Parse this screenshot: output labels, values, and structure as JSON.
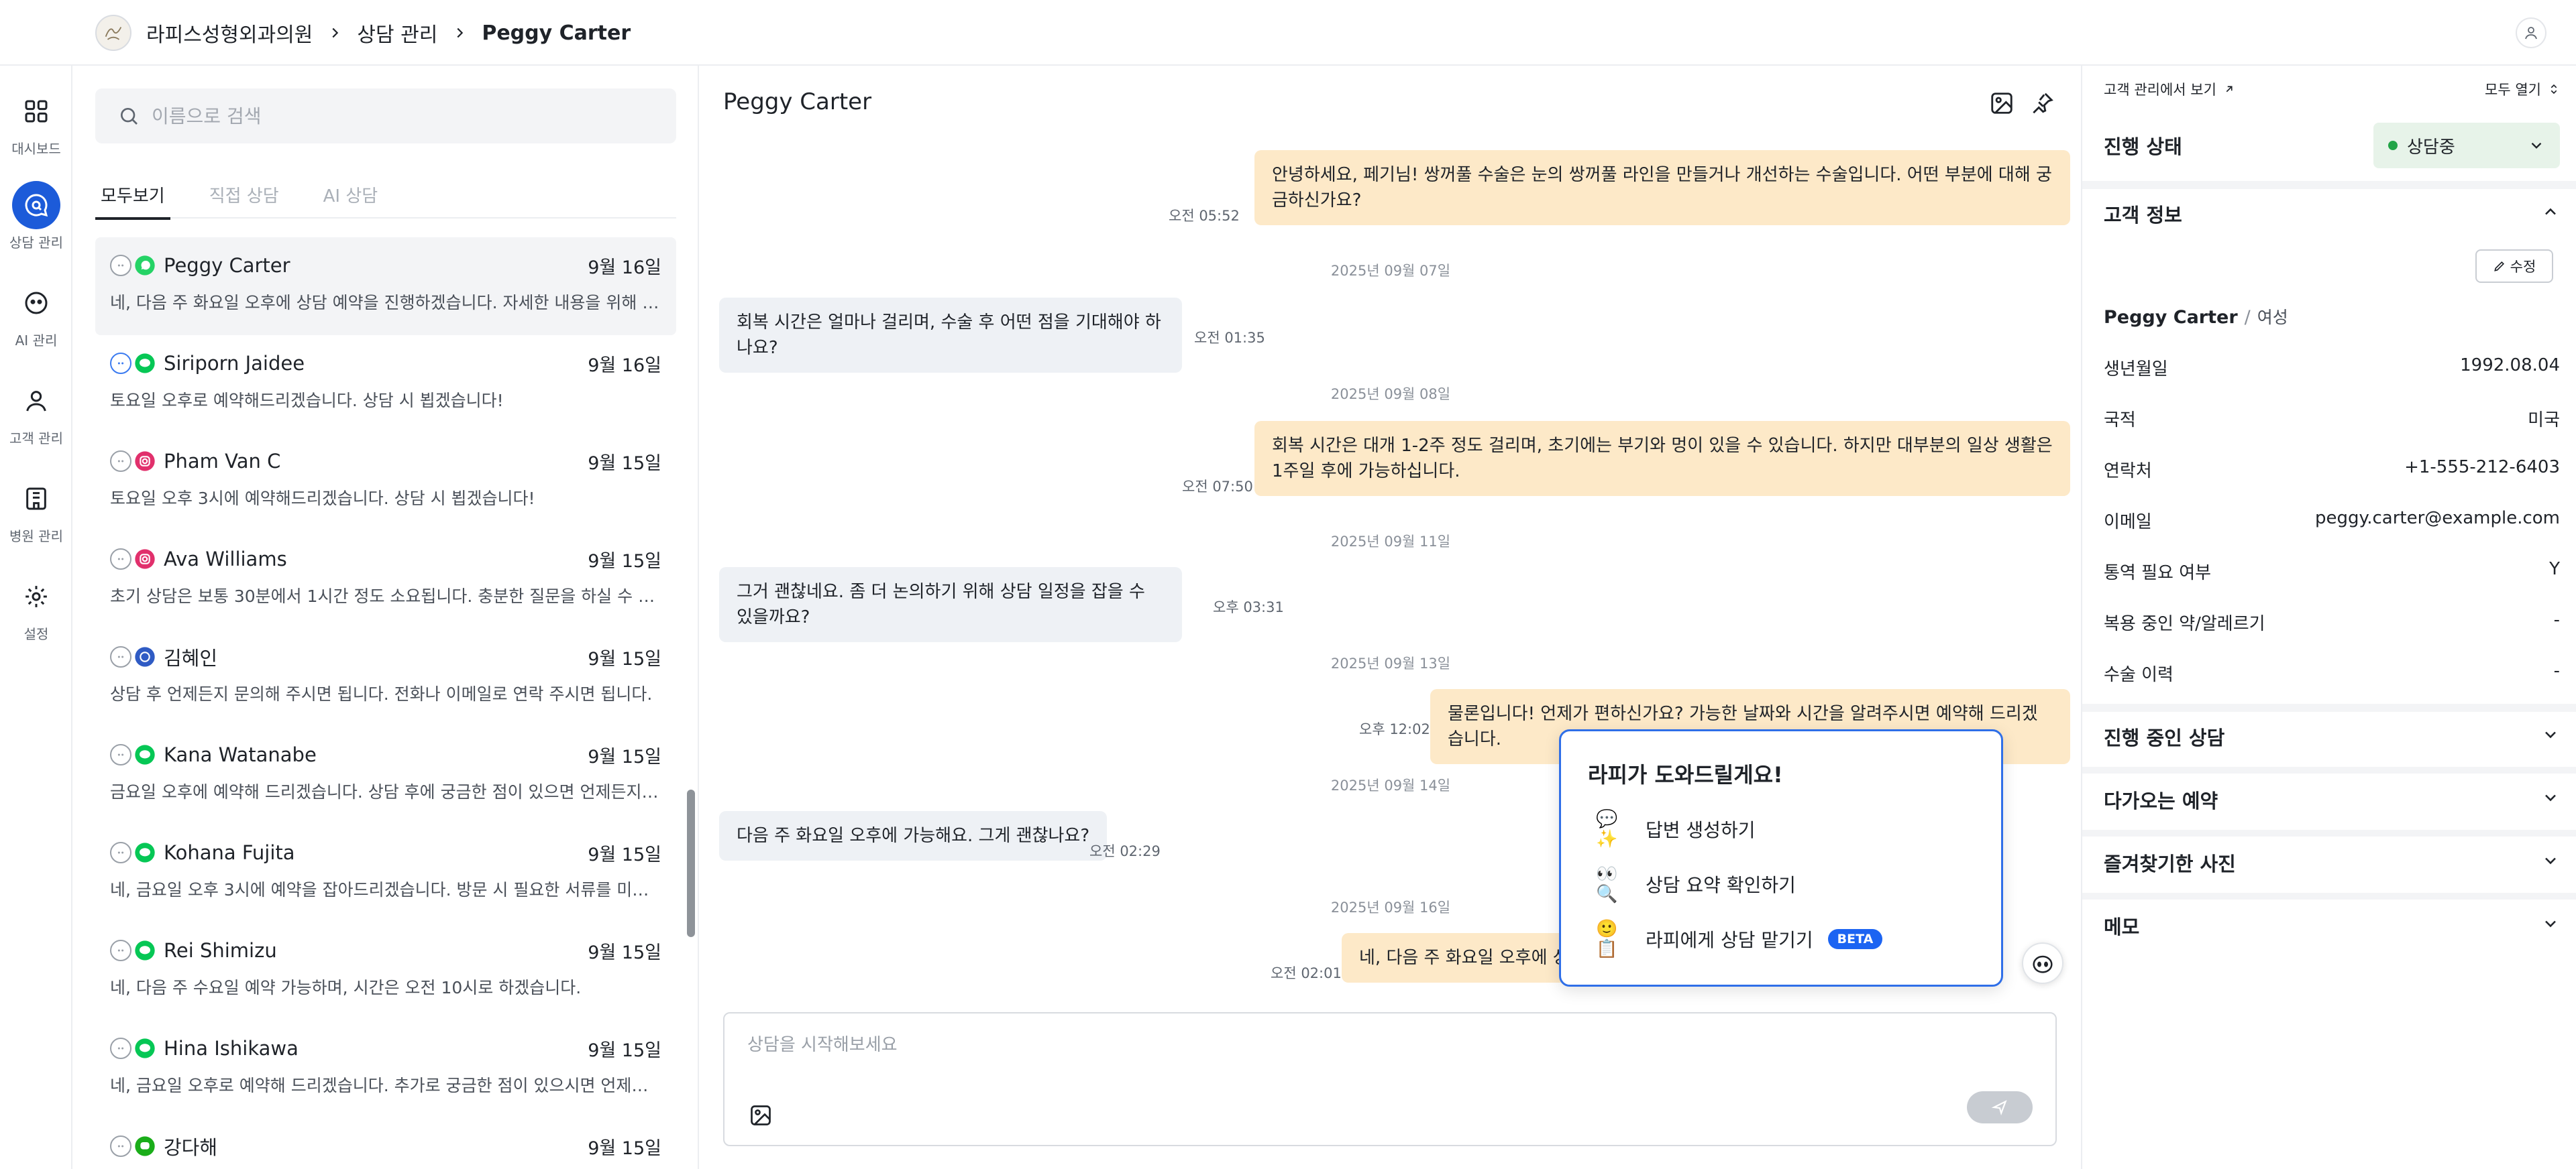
{
  "header": {
    "breadcrumb": [
      "라피스성형외과의원",
      "상담 관리",
      "Peggy Carter"
    ]
  },
  "nav": [
    {
      "label": "대시보드",
      "icon": "grid-icon"
    },
    {
      "label": "상담 관리",
      "icon": "chat-search-icon",
      "active": true
    },
    {
      "label": "AI 관리",
      "icon": "robot-icon"
    },
    {
      "label": "고객 관리",
      "icon": "user-icon"
    },
    {
      "label": "병원 관리",
      "icon": "building-icon"
    },
    {
      "label": "설정",
      "icon": "gear-icon"
    }
  ],
  "search": {
    "placeholder": "이름으로 검색"
  },
  "tabs": [
    "모두보기",
    "직접 상담",
    "AI 상담"
  ],
  "conversations": [
    {
      "name": "Peggy Carter",
      "date": "9월 16일",
      "channel": "whatsapp",
      "message": "네, 다음 주 화요일 오후에 상담 예약을 진행하겠습니다. 자세한 내용을 위해 문의해 주셔서 감사합니다."
    },
    {
      "name": "Siriporn Jaidee",
      "date": "9월 16일",
      "channel": "line",
      "message": "토요일 오후로 예약해드리겠습니다. 상담 시 뵙겠습니다!"
    },
    {
      "name": "Pham Van C",
      "date": "9월 15일",
      "channel": "instagram",
      "message": "토요일 오후 3시에 예약해드리겠습니다. 상담 시 뵙겠습니다!"
    },
    {
      "name": "Ava Williams",
      "date": "9월 15일",
      "channel": "instagram",
      "message": "초기 상담은 보통 30분에서 1시간 정도 소요됩니다. 충분한 질문을 하실 수 있도록 준비하겠습니다."
    },
    {
      "name": "김혜인",
      "date": "9월 15일",
      "channel": "kakao",
      "message": "상담 후 언제든지 문의해 주시면 됩니다. 전화나 이메일로 연락 주시면 됩니다."
    },
    {
      "name": "Kana Watanabe",
      "date": "9월 15일",
      "channel": "line",
      "message": "금요일 오후에 예약해 드리겠습니다. 상담 후에 궁금한 점이 있으면 언제든지 문의해 주세요."
    },
    {
      "name": "Kohana Fujita",
      "date": "9월 15일",
      "channel": "line",
      "message": "네, 금요일 오후 3시에 예약을 잡아드리겠습니다. 방문 시 필요한 서류를 미리 준비해 주세요."
    },
    {
      "name": "Rei Shimizu",
      "date": "9월 15일",
      "channel": "line",
      "message": "네, 다음 주 수요일 예약 가능하며, 시간은 오전 10시로 하겠습니다."
    },
    {
      "name": "Hina Ishikawa",
      "date": "9월 15일",
      "channel": "line",
      "message": "네, 금요일 오후로 예약해 드리겠습니다. 추가로 궁금한 점이 있으시면 언제든지 문의해 주세요."
    },
    {
      "name": "강다해",
      "date": "9월 15일",
      "channel": "wechat",
      "message": ""
    }
  ],
  "chat": {
    "title": "Peggy Carter",
    "messages": [
      {
        "dir": "out",
        "text": "안녕하세요, 페기님! 쌍꺼풀 수술은 눈의 쌍꺼풀 라인을 만들거나 개선하는 수술입니다. 어떤 부분에 대해 궁금하신가요?",
        "time": "오전 05:52"
      },
      {
        "date": "2025년 09월 07일"
      },
      {
        "dir": "in",
        "text": "회복 시간은 얼마나 걸리며, 수술 후 어떤 점을 기대해야 하나요?",
        "time": "오전 01:35"
      },
      {
        "date": "2025년 09월 08일"
      },
      {
        "dir": "out",
        "text": "회복 시간은 대개 1-2주 정도 걸리며, 초기에는 부기와 멍이 있을 수 있습니다. 하지만 대부분의 일상 생활은 1주일 후에 가능하십니다.",
        "time": "오전 07:50"
      },
      {
        "date": "2025년 09월 11일"
      },
      {
        "dir": "in",
        "text": "그거 괜찮네요. 좀 더 논의하기 위해 상담 일정을 잡을 수 있을까요?",
        "time": "오후 03:31"
      },
      {
        "date": "2025년 09월 13일"
      },
      {
        "dir": "out",
        "text": "물론입니다! 언제가 편하신가요? 가능한 날짜와 시간을 알려주시면 예약해 드리겠습니다.",
        "time": "오후 12:02"
      },
      {
        "date": "2025년 09월 14일"
      },
      {
        "dir": "in",
        "text": "다음 주 화요일 오후에 가능해요. 그게 괜찮나요?",
        "time": "오전 02:29"
      },
      {
        "date": "2025년 09월 16일"
      },
      {
        "dir": "out",
        "text": "네, 다음 주 화요일 오후에 상담 예약을 진행하겠습니다.",
        "time": "오전 02:01"
      }
    ],
    "composer_placeholder": "상담을 시작해보세요"
  },
  "assistant": {
    "title": "라피가 도와드릴게요!",
    "items": [
      {
        "emoji": "💬✨",
        "label": "답변 생성하기"
      },
      {
        "emoji": "👀🔍",
        "label": "상담 요약 확인하기"
      },
      {
        "emoji": "🙂📋",
        "label": "라피에게 상담 맡기기",
        "badge": "BETA"
      }
    ]
  },
  "panel": {
    "view_link": "고객 관리에서 보기",
    "expand_all": "모두 열기",
    "status_label": "진행 상태",
    "status_value": "상담중",
    "status_color": "#22a447",
    "info_title": "고객 정보",
    "edit_label": "수정",
    "customer_name": "Peggy Carter",
    "gender": "여성",
    "fields": [
      {
        "label": "생년월일",
        "value": "1992.08.04"
      },
      {
        "label": "국적",
        "value": "미국"
      },
      {
        "label": "연락처",
        "value": "+1-555-212-6403"
      },
      {
        "label": "이메일",
        "value": "peggy.carter@example.com"
      },
      {
        "label": "통역 필요 여부",
        "value": "Y"
      },
      {
        "label": "복용 중인 약/알레르기",
        "value": "-"
      },
      {
        "label": "수술 이력",
        "value": "-"
      }
    ],
    "sections": [
      "진행 중인 상담",
      "다가오는 예약",
      "즐겨찾기한 사진",
      "메모"
    ]
  },
  "colors": {
    "accent": "#1c5bd9",
    "outgoing_bubble": "#fde9c8",
    "incoming_bubble": "#eef1f5"
  }
}
